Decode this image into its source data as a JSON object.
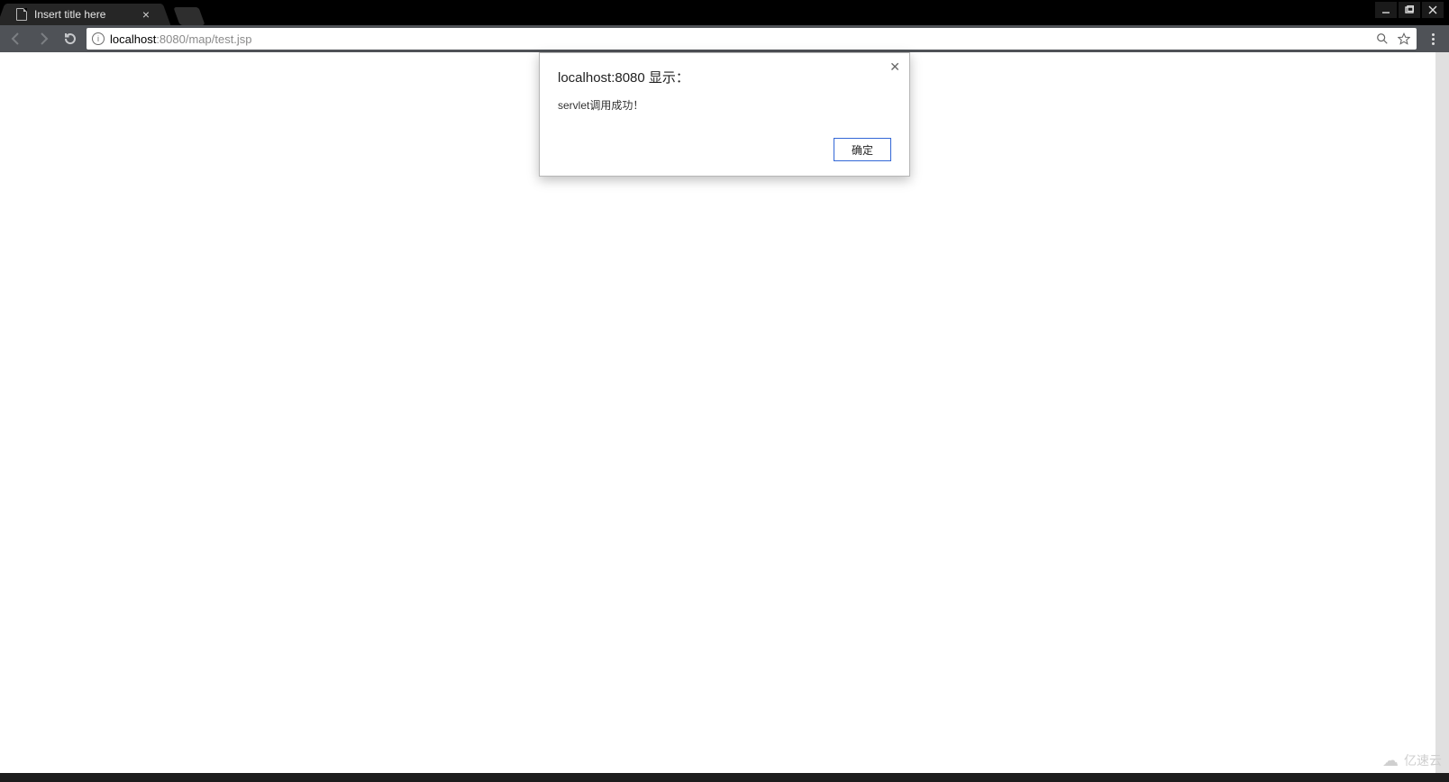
{
  "tab": {
    "title": "Insert title here"
  },
  "address": {
    "hostname": "localhost",
    "port_path": ":8080/map/test.jsp"
  },
  "alert": {
    "title": "localhost:8080 显示：",
    "message": "servlet调用成功！",
    "ok_label": "确定"
  },
  "watermark": {
    "text": "亿速云"
  }
}
